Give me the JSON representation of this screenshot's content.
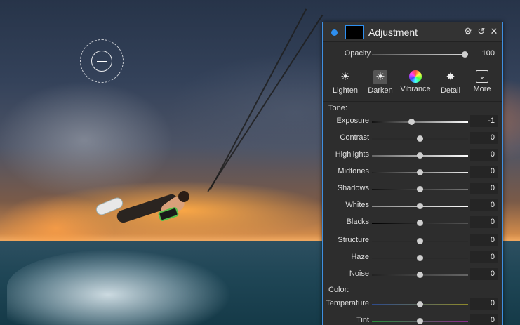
{
  "panel": {
    "title": "Adjustment",
    "icons": {
      "settings": "gear-icon",
      "reset": "undo-icon",
      "close": "close-icon"
    },
    "accent_color": "#2e8ff0"
  },
  "opacity": {
    "label": "Opacity",
    "value": "100"
  },
  "presets": [
    {
      "label": "Lighten",
      "icon": "sun-icon"
    },
    {
      "label": "Darken",
      "icon": "dark-sun-icon"
    },
    {
      "label": "Vibrance",
      "icon": "color-wheel-icon"
    },
    {
      "label": "Detail",
      "icon": "detail-star-icon"
    },
    {
      "label": "More",
      "icon": "chevron-down-icon"
    }
  ],
  "tone": {
    "label": "Tone:",
    "sliders": [
      {
        "label": "Exposure",
        "value": "-1"
      },
      {
        "label": "Contrast",
        "value": "0"
      },
      {
        "label": "Highlights",
        "value": "0"
      },
      {
        "label": "Midtones",
        "value": "0"
      },
      {
        "label": "Shadows",
        "value": "0"
      },
      {
        "label": "Whites",
        "value": "0"
      },
      {
        "label": "Blacks",
        "value": "0"
      }
    ]
  },
  "detail_sliders": [
    {
      "label": "Structure",
      "value": "0"
    },
    {
      "label": "Haze",
      "value": "0"
    },
    {
      "label": "Noise",
      "value": "0"
    }
  ],
  "color": {
    "label": "Color:",
    "sliders": [
      {
        "label": "Temperature",
        "value": "0"
      },
      {
        "label": "Tint",
        "value": "0"
      }
    ]
  }
}
